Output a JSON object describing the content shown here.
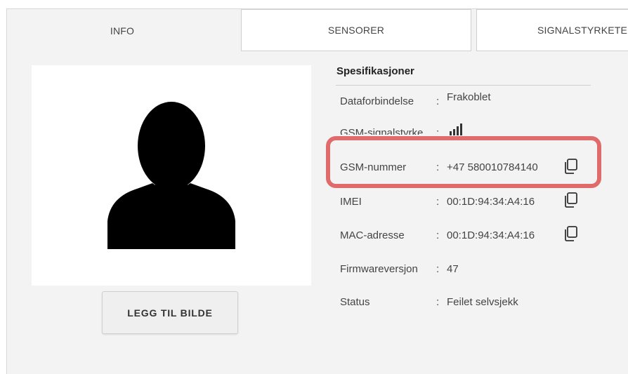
{
  "tabs": [
    {
      "label": "INFO",
      "active": true
    },
    {
      "label": "SENSORER",
      "active": false
    },
    {
      "label": "SIGNALSTYRKETE",
      "active": false
    }
  ],
  "add_image_button": "LEGG TIL BILDE",
  "spec": {
    "title": "Spesifikasjoner",
    "rows": [
      {
        "label": "Dataforbindelse",
        "value": "Frakoblet"
      },
      {
        "label": "GSM-signalstyrke",
        "value": ""
      },
      {
        "label": "GSM-nummer",
        "value": "+47 580010784140"
      },
      {
        "label": "IMEI",
        "value": "00:1D:94:34:A4:16"
      },
      {
        "label": "MAC-adresse",
        "value": "00:1D:94:34:A4:16"
      },
      {
        "label": "Firmwareversjon",
        "value": "47"
      },
      {
        "label": "Status",
        "value": "Feilet selvsjekk"
      }
    ],
    "colon": ":"
  },
  "icons": {
    "avatar": "person-silhouette-icon",
    "signal": "signal-bars-icon",
    "copy": "copy-icon"
  },
  "colors": {
    "highlight": "#e06b6b",
    "panel_bg": "#f3f3f3"
  }
}
